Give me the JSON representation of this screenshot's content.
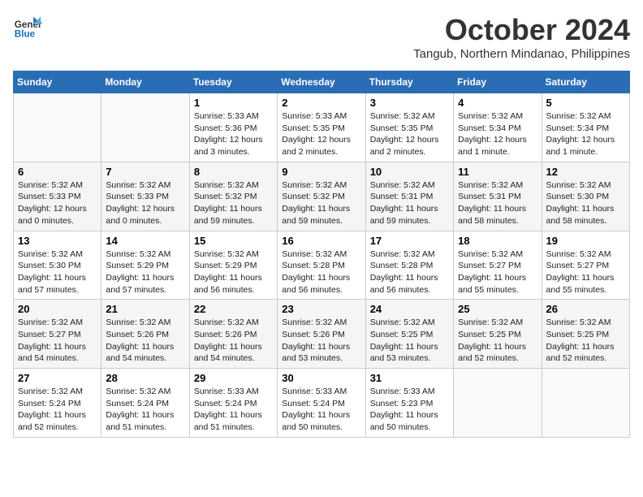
{
  "header": {
    "logo_line1": "General",
    "logo_line2": "Blue",
    "month": "October 2024",
    "location": "Tangub, Northern Mindanao, Philippines"
  },
  "days_of_week": [
    "Sunday",
    "Monday",
    "Tuesday",
    "Wednesday",
    "Thursday",
    "Friday",
    "Saturday"
  ],
  "weeks": [
    [
      {
        "day": "",
        "info": ""
      },
      {
        "day": "",
        "info": ""
      },
      {
        "day": "1",
        "info": "Sunrise: 5:33 AM\nSunset: 5:36 PM\nDaylight: 12 hours\nand 3 minutes."
      },
      {
        "day": "2",
        "info": "Sunrise: 5:33 AM\nSunset: 5:35 PM\nDaylight: 12 hours\nand 2 minutes."
      },
      {
        "day": "3",
        "info": "Sunrise: 5:32 AM\nSunset: 5:35 PM\nDaylight: 12 hours\nand 2 minutes."
      },
      {
        "day": "4",
        "info": "Sunrise: 5:32 AM\nSunset: 5:34 PM\nDaylight: 12 hours\nand 1 minute."
      },
      {
        "day": "5",
        "info": "Sunrise: 5:32 AM\nSunset: 5:34 PM\nDaylight: 12 hours\nand 1 minute."
      }
    ],
    [
      {
        "day": "6",
        "info": "Sunrise: 5:32 AM\nSunset: 5:33 PM\nDaylight: 12 hours\nand 0 minutes."
      },
      {
        "day": "7",
        "info": "Sunrise: 5:32 AM\nSunset: 5:33 PM\nDaylight: 12 hours\nand 0 minutes."
      },
      {
        "day": "8",
        "info": "Sunrise: 5:32 AM\nSunset: 5:32 PM\nDaylight: 11 hours\nand 59 minutes."
      },
      {
        "day": "9",
        "info": "Sunrise: 5:32 AM\nSunset: 5:32 PM\nDaylight: 11 hours\nand 59 minutes."
      },
      {
        "day": "10",
        "info": "Sunrise: 5:32 AM\nSunset: 5:31 PM\nDaylight: 11 hours\nand 59 minutes."
      },
      {
        "day": "11",
        "info": "Sunrise: 5:32 AM\nSunset: 5:31 PM\nDaylight: 11 hours\nand 58 minutes."
      },
      {
        "day": "12",
        "info": "Sunrise: 5:32 AM\nSunset: 5:30 PM\nDaylight: 11 hours\nand 58 minutes."
      }
    ],
    [
      {
        "day": "13",
        "info": "Sunrise: 5:32 AM\nSunset: 5:30 PM\nDaylight: 11 hours\nand 57 minutes."
      },
      {
        "day": "14",
        "info": "Sunrise: 5:32 AM\nSunset: 5:29 PM\nDaylight: 11 hours\nand 57 minutes."
      },
      {
        "day": "15",
        "info": "Sunrise: 5:32 AM\nSunset: 5:29 PM\nDaylight: 11 hours\nand 56 minutes."
      },
      {
        "day": "16",
        "info": "Sunrise: 5:32 AM\nSunset: 5:28 PM\nDaylight: 11 hours\nand 56 minutes."
      },
      {
        "day": "17",
        "info": "Sunrise: 5:32 AM\nSunset: 5:28 PM\nDaylight: 11 hours\nand 56 minutes."
      },
      {
        "day": "18",
        "info": "Sunrise: 5:32 AM\nSunset: 5:27 PM\nDaylight: 11 hours\nand 55 minutes."
      },
      {
        "day": "19",
        "info": "Sunrise: 5:32 AM\nSunset: 5:27 PM\nDaylight: 11 hours\nand 55 minutes."
      }
    ],
    [
      {
        "day": "20",
        "info": "Sunrise: 5:32 AM\nSunset: 5:27 PM\nDaylight: 11 hours\nand 54 minutes."
      },
      {
        "day": "21",
        "info": "Sunrise: 5:32 AM\nSunset: 5:26 PM\nDaylight: 11 hours\nand 54 minutes."
      },
      {
        "day": "22",
        "info": "Sunrise: 5:32 AM\nSunset: 5:26 PM\nDaylight: 11 hours\nand 54 minutes."
      },
      {
        "day": "23",
        "info": "Sunrise: 5:32 AM\nSunset: 5:26 PM\nDaylight: 11 hours\nand 53 minutes."
      },
      {
        "day": "24",
        "info": "Sunrise: 5:32 AM\nSunset: 5:25 PM\nDaylight: 11 hours\nand 53 minutes."
      },
      {
        "day": "25",
        "info": "Sunrise: 5:32 AM\nSunset: 5:25 PM\nDaylight: 11 hours\nand 52 minutes."
      },
      {
        "day": "26",
        "info": "Sunrise: 5:32 AM\nSunset: 5:25 PM\nDaylight: 11 hours\nand 52 minutes."
      }
    ],
    [
      {
        "day": "27",
        "info": "Sunrise: 5:32 AM\nSunset: 5:24 PM\nDaylight: 11 hours\nand 52 minutes."
      },
      {
        "day": "28",
        "info": "Sunrise: 5:32 AM\nSunset: 5:24 PM\nDaylight: 11 hours\nand 51 minutes."
      },
      {
        "day": "29",
        "info": "Sunrise: 5:33 AM\nSunset: 5:24 PM\nDaylight: 11 hours\nand 51 minutes."
      },
      {
        "day": "30",
        "info": "Sunrise: 5:33 AM\nSunset: 5:24 PM\nDaylight: 11 hours\nand 50 minutes."
      },
      {
        "day": "31",
        "info": "Sunrise: 5:33 AM\nSunset: 5:23 PM\nDaylight: 11 hours\nand 50 minutes."
      },
      {
        "day": "",
        "info": ""
      },
      {
        "day": "",
        "info": ""
      }
    ]
  ]
}
